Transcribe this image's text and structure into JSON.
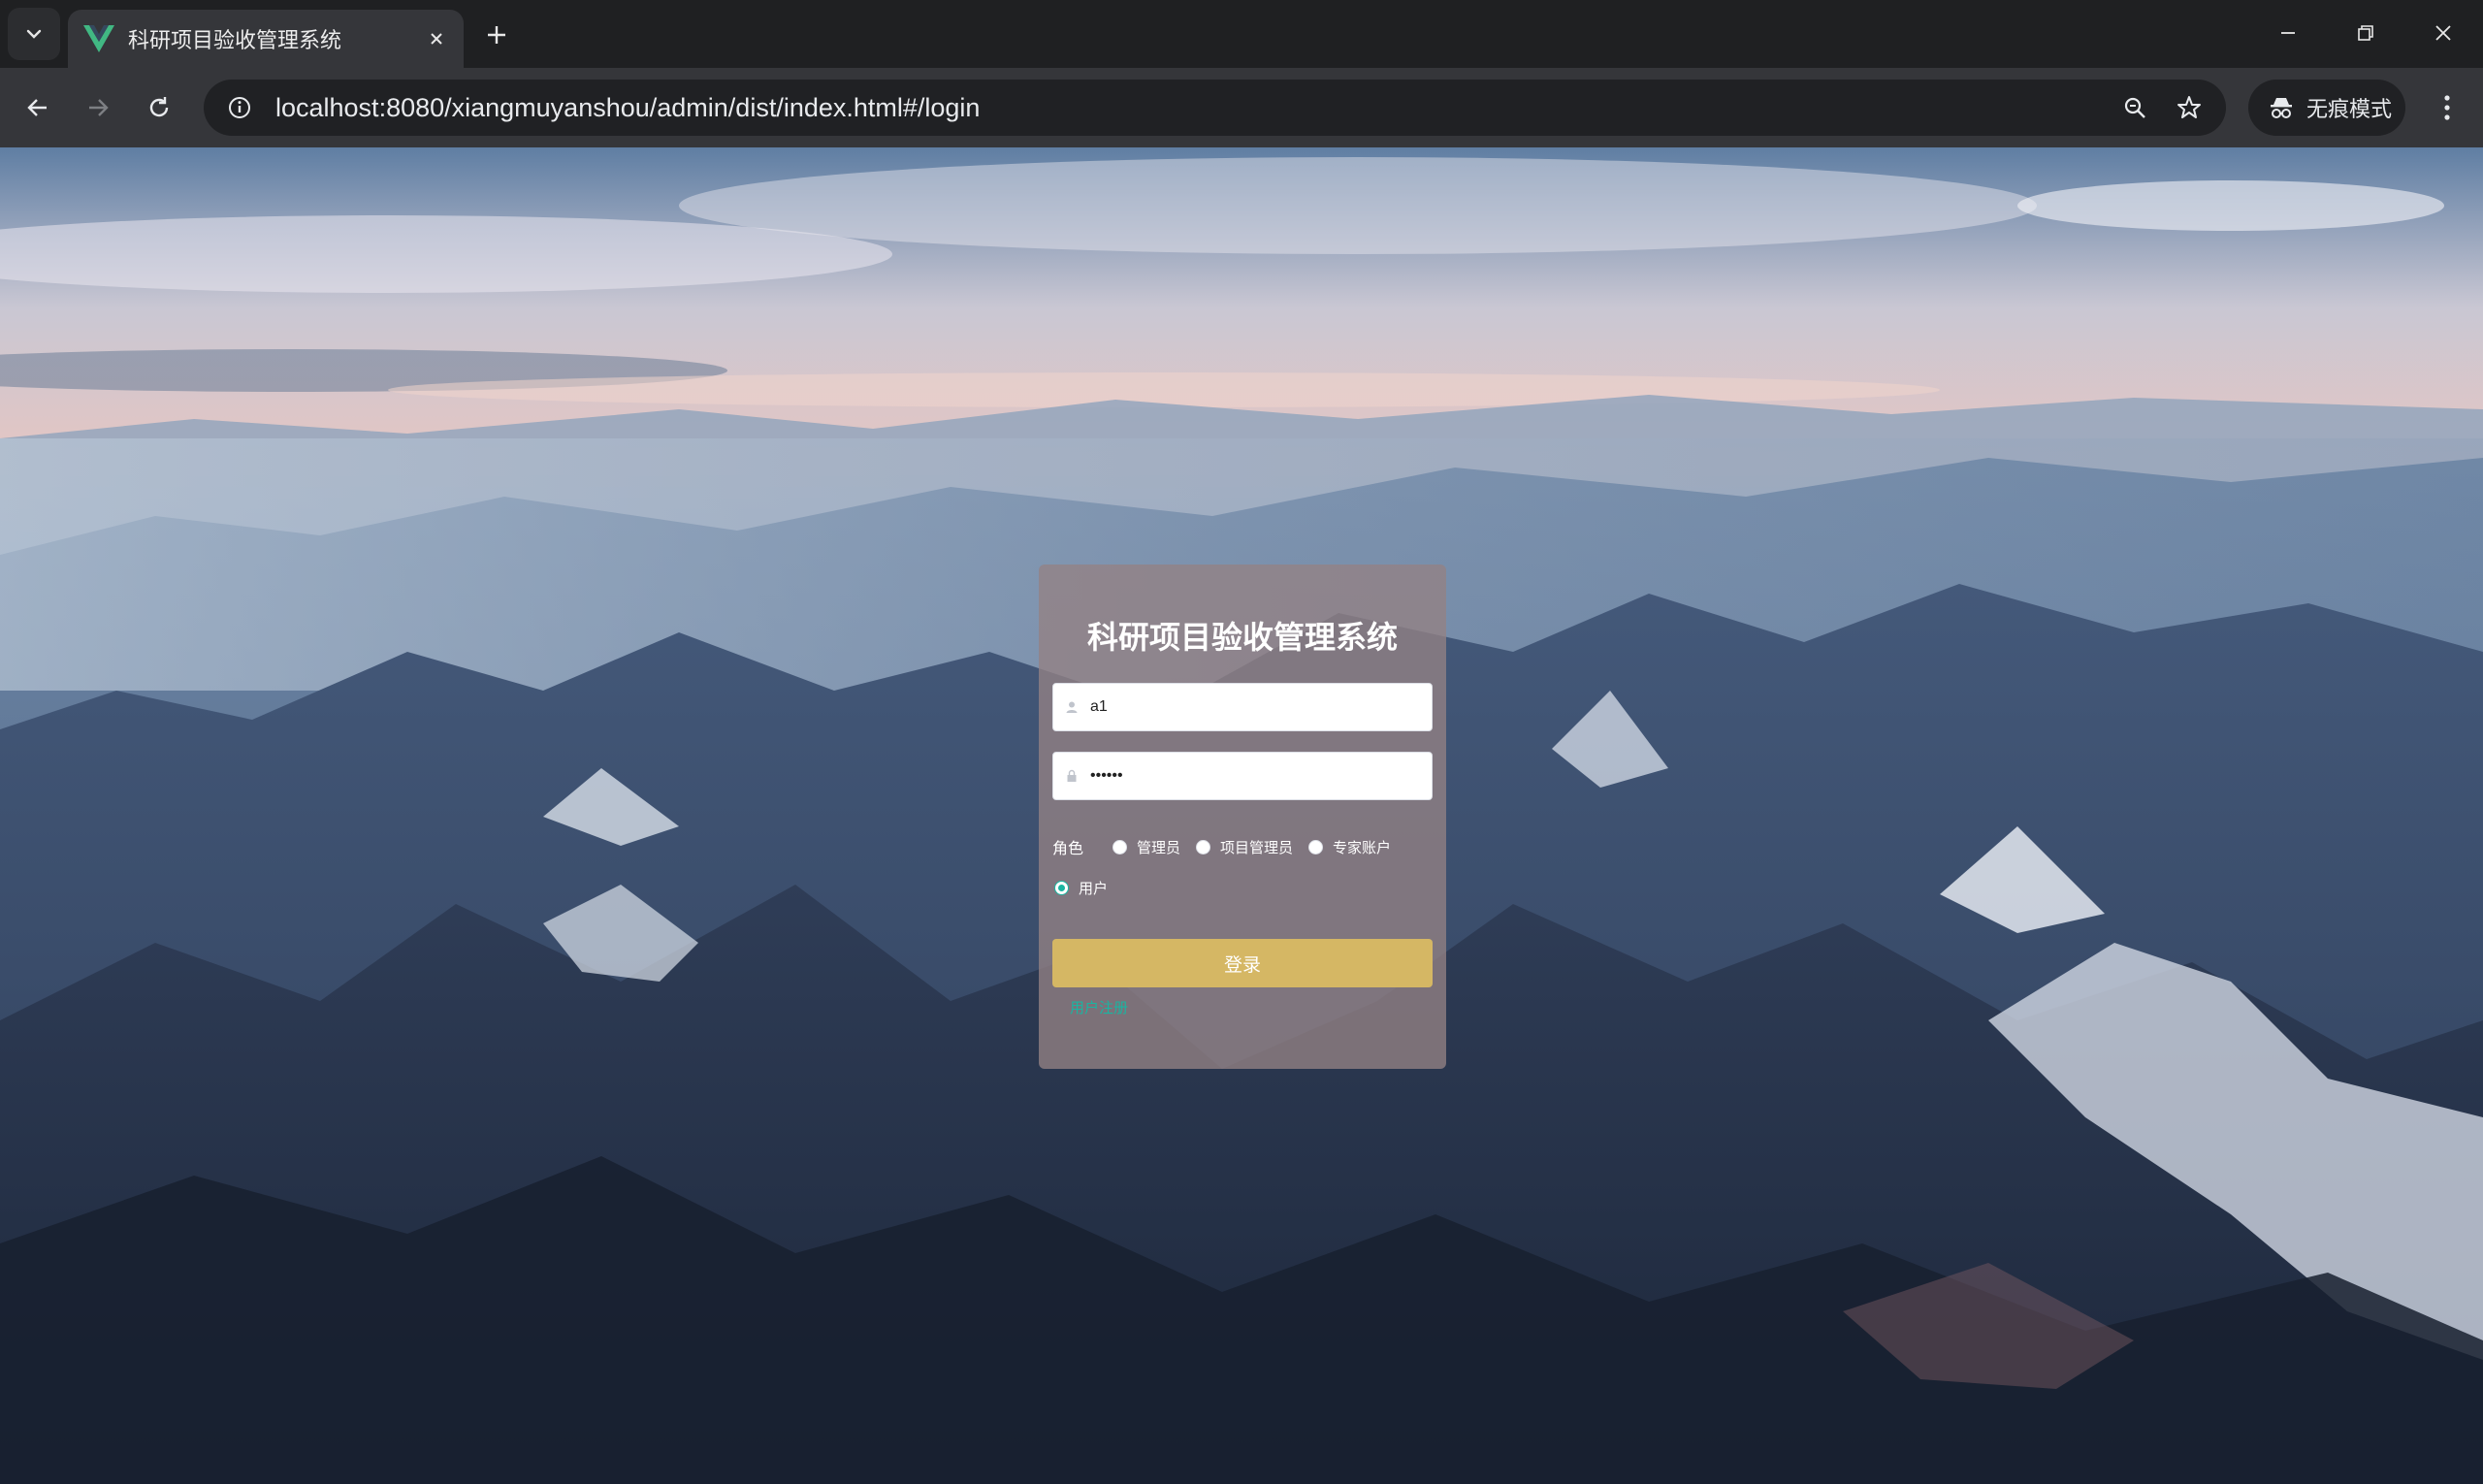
{
  "browser": {
    "tab_title": "科研项目验收管理系统",
    "url": "localhost:8080/xiangmuyanshou/admin/dist/index.html#/login",
    "incognito_label": "无痕模式",
    "accent_favicon": "#41b883"
  },
  "login": {
    "title": "科研项目验收管理系统",
    "username_value": "a1",
    "password_value": "••••••",
    "role_label": "角色",
    "roles": [
      {
        "label": "管理员",
        "checked": false
      },
      {
        "label": "项目管理员",
        "checked": false
      },
      {
        "label": "专家账户",
        "checked": false
      },
      {
        "label": "用户",
        "checked": true
      }
    ],
    "login_button": "登录",
    "register_link": "用户注册",
    "accent_color": "#19b5a1",
    "button_color": "#d5b764"
  }
}
